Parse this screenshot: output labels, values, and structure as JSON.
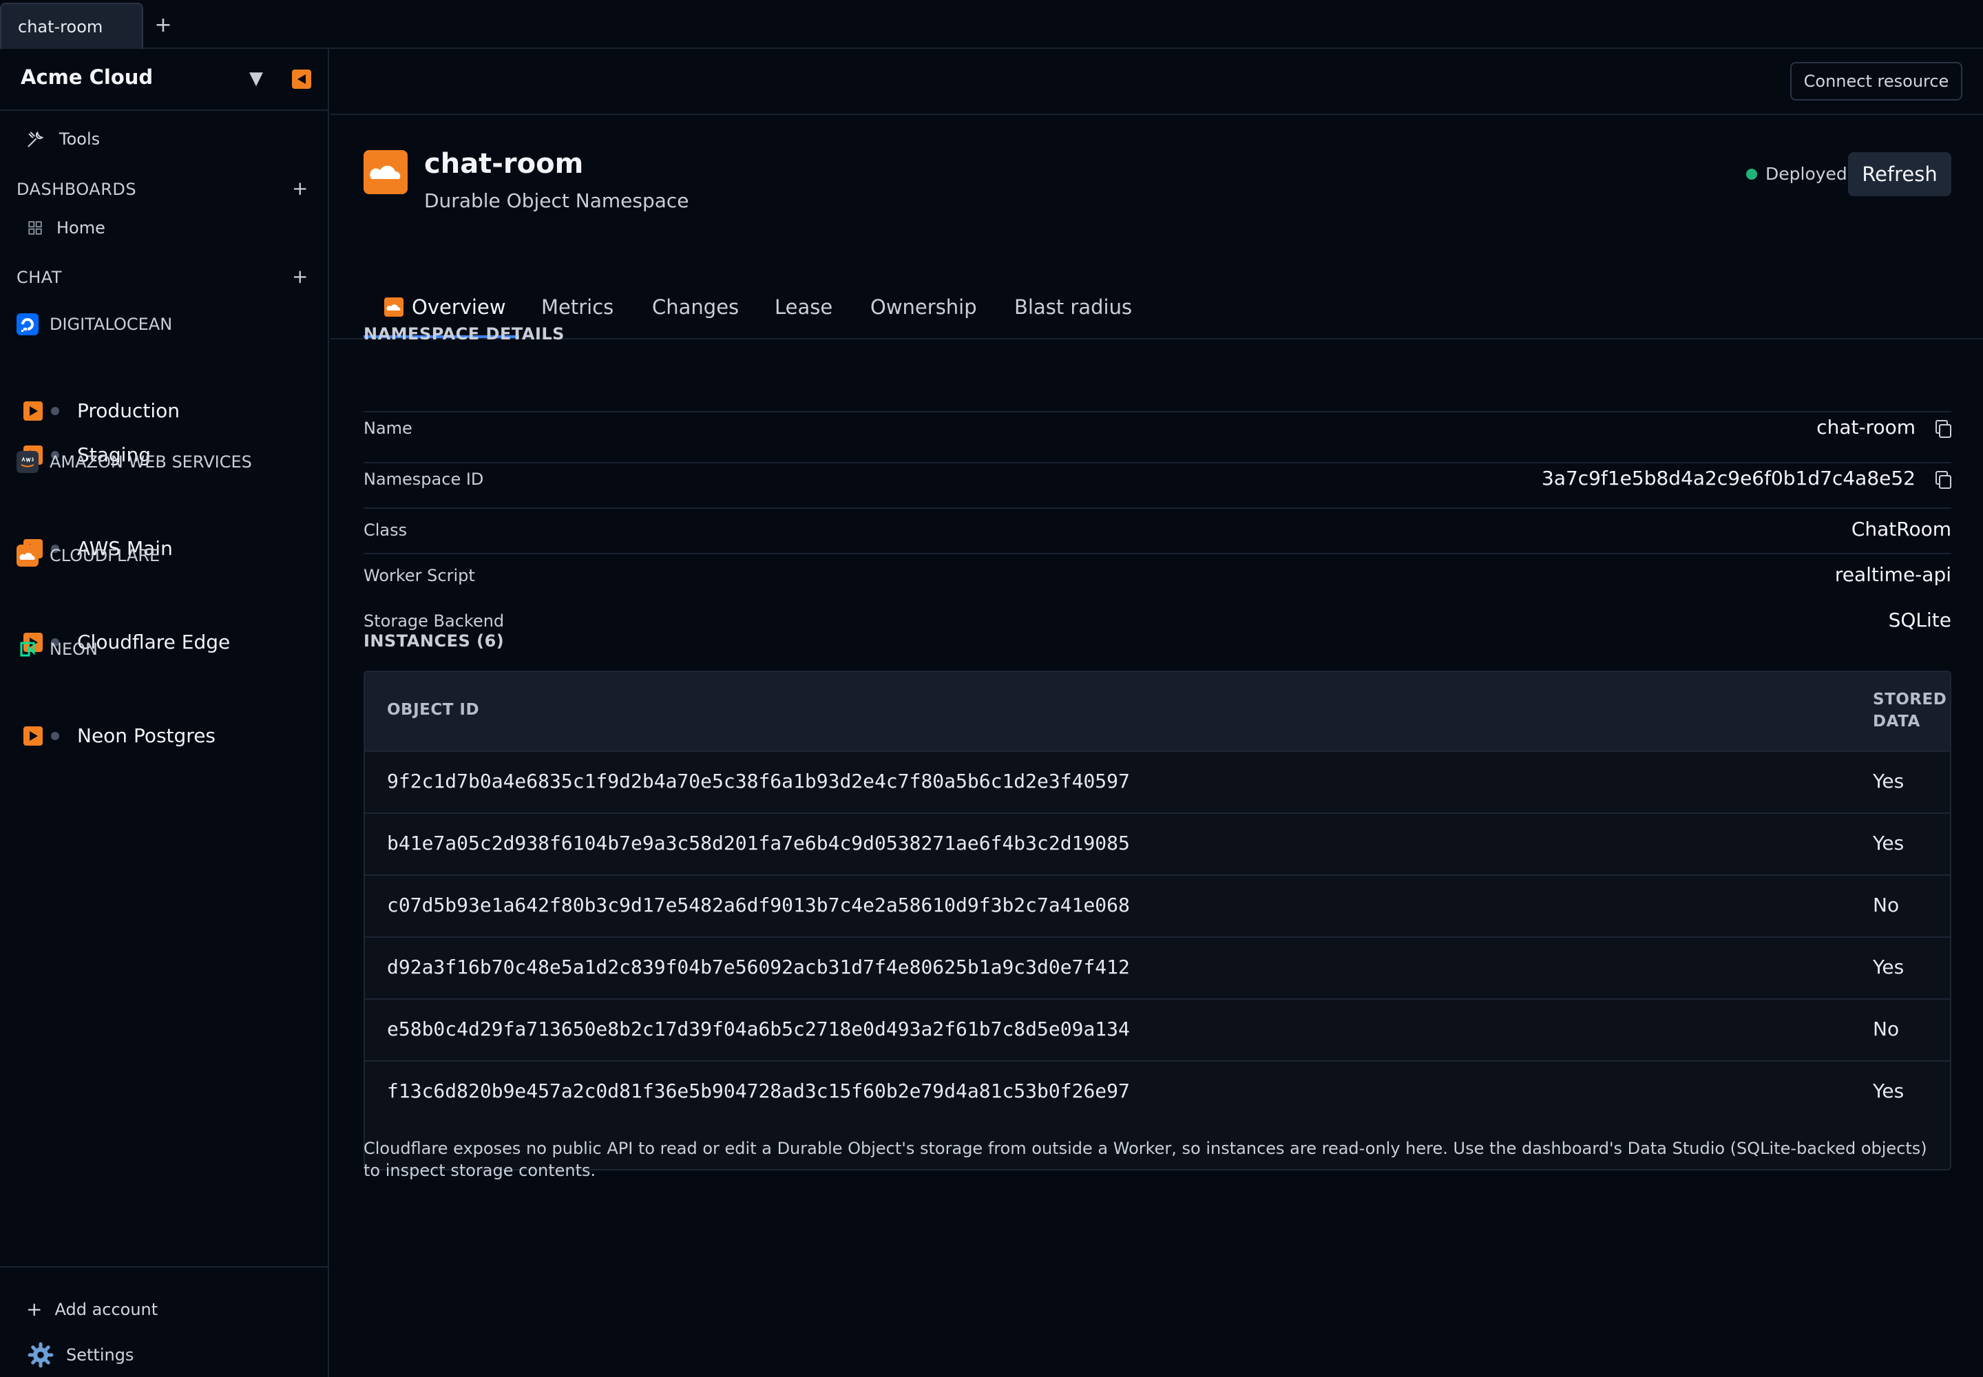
{
  "window": {
    "tab_label": "chat-room",
    "new_tab": "+"
  },
  "sidebar": {
    "brand": "Acme Cloud",
    "brand_caret": "▼",
    "tools_label": "Tools",
    "dashboards_label": "DASHBOARDS",
    "chat_label": "CHAT",
    "add_symbol": "+",
    "home_label": "Home",
    "providers": [
      {
        "name": "DIGITALOCEAN",
        "accounts": [
          "Production",
          "Staging"
        ]
      },
      {
        "name": "AMAZON WEB SERVICES",
        "accounts": [
          "AWS Main"
        ]
      },
      {
        "name": "CLOUDFLARE",
        "accounts": [
          "Cloudflare Edge"
        ]
      },
      {
        "name": "NEON",
        "accounts": [
          "Neon Postgres"
        ]
      }
    ],
    "add_account_label": "Add account",
    "settings_label": "Settings"
  },
  "header": {
    "connect_label": "Connect resource"
  },
  "resource": {
    "title": "chat-room",
    "subtitle": "Durable Object Namespace",
    "status": "Deployed",
    "refresh_label": "Refresh"
  },
  "tabs": [
    {
      "label": "Overview"
    },
    {
      "label": "Metrics"
    },
    {
      "label": "Changes"
    },
    {
      "label": "Lease"
    },
    {
      "label": "Ownership"
    },
    {
      "label": "Blast radius"
    }
  ],
  "details": {
    "heading": "NAMESPACE DETAILS",
    "rows": [
      {
        "label": "Name",
        "value": "chat-room"
      },
      {
        "label": "Namespace ID",
        "value": "3a7c9f1e5b8d4a2c9e6f0b1d7c4a8e52"
      },
      {
        "label": "Class",
        "value": "ChatRoom"
      },
      {
        "label": "Worker Script",
        "value": "realtime-api"
      },
      {
        "label": "Storage Backend",
        "value": "SQLite"
      }
    ]
  },
  "instances": {
    "heading": "INSTANCES (6)",
    "columns": [
      "OBJECT ID",
      "STORED",
      "DATA"
    ],
    "rows": [
      {
        "id": "9f2c1d7b0a4e6835c1f9d2b4a70e5c38f6a1b93d2e4c7f80a5b6c1d2e3f40597",
        "stored": "Yes"
      },
      {
        "id": "b41e7a05c2d938f6104b7e9a3c58d201fa7e6b4c9d0538271ae6f4b3c2d19085",
        "stored": "Yes"
      },
      {
        "id": "c07d5b93e1a642f80b3c9d17e5482a6df9013b7c4e2a58610d9f3b2c7a41e068",
        "stored": "No"
      },
      {
        "id": "d92a3f16b70c48e5a1d2c839f04b7e56092acb31d7f4e80625b1a9c3d0e7f412",
        "stored": "Yes"
      },
      {
        "id": "e58b0c4d29fa713650e8b2c17d39f04a6b5c2718e0d493a2f61b7c8d5e09a134",
        "stored": "No"
      },
      {
        "id": "f13c6d820b9e457a2c0d81f36e5b904728ad3c15f60b2e79d4a81c53b0f26e97",
        "stored": "Yes"
      }
    ]
  },
  "note": "Cloudflare exposes no public API to read or edit a Durable Object's storage from outside a Worker, so instances are read-only here. Use the dashboard's Data Studio (SQLite-backed objects) to inspect storage contents.",
  "colors": {
    "accent": "#3b82f6",
    "cloudflare": "#f38020",
    "status_ok": "#1fb37a",
    "digitalocean": "#0069ff",
    "neon": "#00e599"
  }
}
